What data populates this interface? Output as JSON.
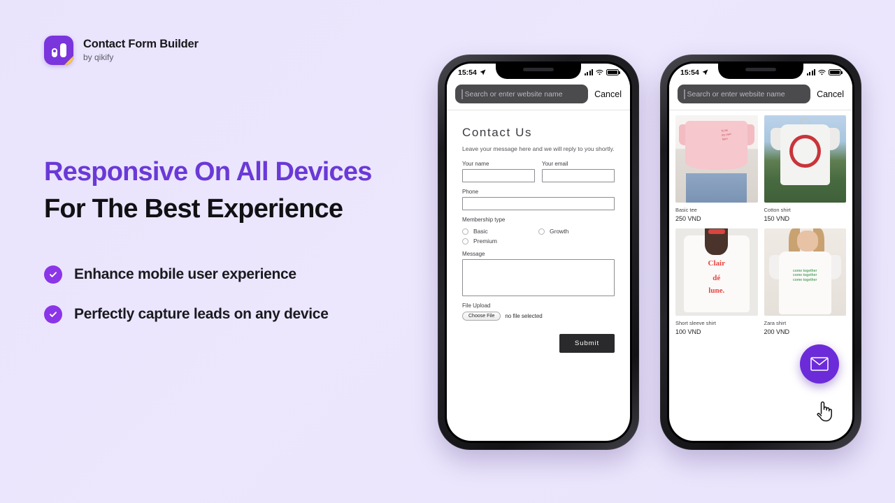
{
  "brand": {
    "title": "Contact Form Builder",
    "subtitle": "by qikify",
    "logo_icon": "app-logo-icon",
    "accent_color": "#7a35dd"
  },
  "hero": {
    "headline_line1": "Responsive On All Devices",
    "headline_line2": "For The Best Experience",
    "headline_color": "#6a39d7",
    "bullets": [
      {
        "label": "Enhance mobile user experience",
        "icon": "check-circle-icon"
      },
      {
        "label": "Perfectly capture leads on any device",
        "icon": "check-circle-icon"
      }
    ]
  },
  "phone_left": {
    "status": {
      "time": "15:54",
      "location_icon": "location-arrow-icon",
      "signal_icon": "cellular-signal-icon",
      "wifi_icon": "wifi-icon",
      "battery_icon": "battery-full-icon"
    },
    "browser": {
      "placeholder": "Search or enter website name",
      "value": "",
      "cancel_label": "Cancel"
    },
    "form": {
      "title": "Contact Us",
      "subtitle": "Leave your message here and we will reply to you shortly.",
      "fields": [
        {
          "label": "Your name",
          "value": ""
        },
        {
          "label": "Your email",
          "value": ""
        },
        {
          "label": "Phone",
          "value": ""
        }
      ],
      "membership": {
        "label": "Membership type",
        "options": [
          "Basic",
          "Growth",
          "Premium"
        ]
      },
      "message_label": "Message",
      "message_value": "",
      "upload_label": "File Upload",
      "choose_file_label": "Choose File",
      "file_status": "no file selected",
      "submit_label": "Submit"
    }
  },
  "phone_right": {
    "status": {
      "time": "15:54",
      "location_icon": "location-arrow-icon",
      "signal_icon": "cellular-signal-icon",
      "wifi_icon": "wifi-icon",
      "battery_icon": "battery-full-icon"
    },
    "browser": {
      "placeholder": "Search or enter website name",
      "value": "",
      "cancel_label": "Cancel"
    },
    "products": [
      {
        "name": "Basic tee",
        "price": "250 VND"
      },
      {
        "name": "Cotton shirt",
        "price": "150 VND"
      },
      {
        "name": "Short sleeve shirt",
        "price": "100 VND"
      },
      {
        "name": "Zara shirt",
        "price": "200 VND"
      }
    ],
    "fab": {
      "icon": "envelope-icon",
      "color": "#6c2bd9"
    },
    "cursor_icon": "pointing-hand-cursor"
  }
}
